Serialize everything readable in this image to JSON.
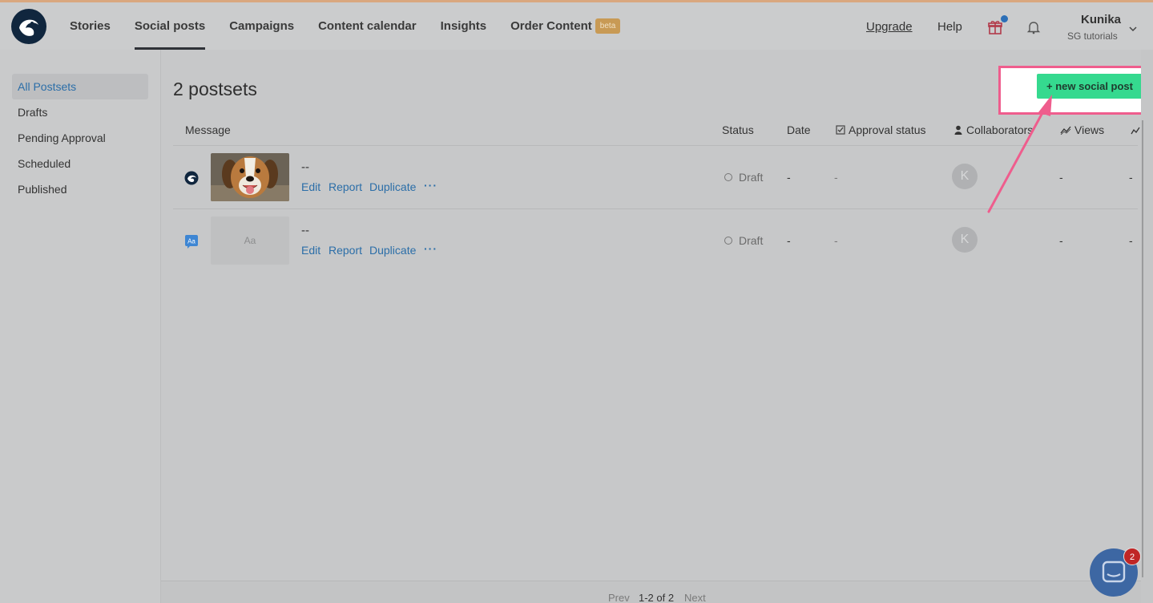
{
  "nav": {
    "items": [
      "Stories",
      "Social posts",
      "Campaigns",
      "Content calendar",
      "Insights",
      "Order Content"
    ],
    "active": "Social posts",
    "beta_badge": "beta",
    "upgrade": "Upgrade",
    "help": "Help",
    "user_name": "Kunika",
    "user_org": "SG tutorials"
  },
  "sidebar": {
    "items": [
      "All Postsets",
      "Drafts",
      "Pending Approval",
      "Scheduled",
      "Published"
    ],
    "active": "All Postsets"
  },
  "main": {
    "title": "2 postsets",
    "new_button": "+ new social post",
    "columns": [
      "Message",
      "Status",
      "Date",
      "Approval status",
      "Collaborators",
      "Views"
    ],
    "rows": [
      {
        "message": "--",
        "thumb": "dog-photo",
        "actions": [
          "Edit",
          "Report",
          "Duplicate",
          "···"
        ],
        "status": "Draft",
        "date": "-",
        "approval": "-",
        "collaborator": "K",
        "views": "-",
        "extra": "-"
      },
      {
        "message": "--",
        "thumb": "Aa",
        "actions": [
          "Edit",
          "Report",
          "Duplicate",
          "···"
        ],
        "status": "Draft",
        "date": "-",
        "approval": "-",
        "collaborator": "K",
        "views": "-",
        "extra": "-"
      }
    ],
    "pagination": {
      "prev": "Prev",
      "range": "1-2 of 2",
      "next": "Next"
    }
  },
  "chat": {
    "badge": "2"
  },
  "colors": {
    "accent_button": "#35d98f",
    "highlight_border": "#ef5d8d",
    "link": "#2b6ea8",
    "logo": "#10263e"
  }
}
